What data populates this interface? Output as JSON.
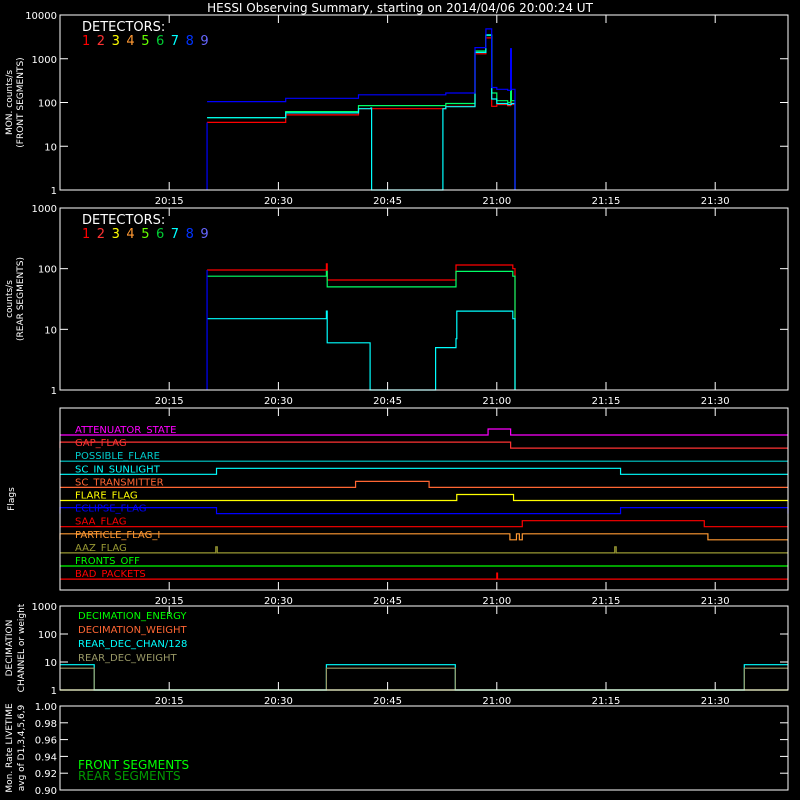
{
  "title": "HESSI Observing Summary, starting on 2014/04/06 20:00:24 UT",
  "colors": {
    "det": [
      "#ff0000",
      "#ff3333",
      "#ffff00",
      "#ff9933",
      "#66ff00",
      "#00cc33",
      "#00ffff",
      "#0033ff",
      "#6666ff"
    ]
  },
  "chart_data": [
    {
      "type": "line",
      "ylabel": "MON. counts/s (FRONT SEGMENTS)",
      "yscale": "log",
      "ylim": [
        1,
        10000
      ],
      "yticks": [
        "1",
        "10",
        "100",
        "1000",
        "10000"
      ],
      "xlabels": [
        "20:15",
        "20:30",
        "20:45",
        "21:00",
        "21:15",
        "21:30"
      ],
      "legend_title": "DETECTORS:",
      "legend_numbers": [
        "1",
        "2",
        "3",
        "4",
        "5",
        "6",
        "7",
        "8",
        "9"
      ],
      "series": [
        {
          "name": "1",
          "color": "#ff0000",
          "x": [
            20.2,
            31,
            41,
            53,
            57,
            58.5,
            59.3,
            60,
            61.5,
            61.9,
            62,
            62.5
          ],
          "y": [
            35,
            52,
            72,
            82,
            1300,
            3000,
            82,
            90,
            85,
            1100,
            90,
            1
          ]
        },
        {
          "name": "6",
          "color": "#00ff66",
          "x": [
            20.2,
            31,
            41,
            53,
            57,
            58.5,
            59.3,
            60,
            61.5,
            61.9,
            62,
            62.5
          ],
          "y": [
            45,
            62,
            85,
            95,
            1500,
            3400,
            165,
            110,
            100,
            1300,
            110,
            1
          ]
        },
        {
          "name": "7",
          "color": "#00ffff",
          "x": [
            20.2,
            31,
            41,
            42.7,
            42.8,
            52.5,
            52.6,
            53,
            57,
            58.5,
            59.3,
            60,
            61.5,
            62,
            62.5
          ],
          "y": [
            45,
            58,
            72,
            75,
            1,
            1,
            72,
            80,
            1400,
            3500,
            120,
            95,
            90,
            95,
            1
          ]
        },
        {
          "name": "8",
          "color": "#0000ff",
          "x": [
            20.2,
            31,
            41,
            53,
            57,
            58.5,
            59.3,
            60,
            61.5,
            61.9,
            62,
            62.5
          ],
          "y": [
            105,
            125,
            150,
            165,
            1800,
            4800,
            220,
            200,
            190,
            1700,
            200,
            1
          ]
        }
      ]
    },
    {
      "type": "line",
      "ylabel": "counts/s (REAR SEGMENTS)",
      "yscale": "log",
      "ylim": [
        1,
        1000
      ],
      "yticks": [
        "1",
        "10",
        "100",
        "1000"
      ],
      "xlabels": [
        "20:15",
        "20:30",
        "20:45",
        "21:00",
        "21:15",
        "21:30"
      ],
      "legend_title": "DETECTORS:",
      "legend_numbers": [
        "1",
        "2",
        "3",
        "4",
        "5",
        "6",
        "7",
        "8",
        "9"
      ],
      "series": [
        {
          "name": "1",
          "color": "#ff0000",
          "x": [
            20.2,
            36.6,
            36.7,
            54.3,
            54.4,
            62.2,
            62.5
          ],
          "y": [
            95,
            120,
            65,
            65,
            115,
            100,
            1
          ]
        },
        {
          "name": "5",
          "color": "#00ff66",
          "x": [
            20.2,
            36.6,
            36.7,
            54.3,
            54.4,
            62.2,
            62.5
          ],
          "y": [
            75,
            90,
            50,
            50,
            90,
            75,
            1
          ]
        },
        {
          "name": "7",
          "color": "#00ffff",
          "x": [
            20.2,
            36.6,
            36.7,
            38.4,
            38.5,
            42.6,
            42.7,
            51.5,
            51.6,
            54.4,
            54.5,
            62.2,
            62.5
          ],
          "y": [
            15,
            20,
            6,
            6,
            6,
            1,
            1,
            1,
            5,
            7,
            20,
            15,
            1
          ]
        }
      ]
    },
    {
      "type": "table",
      "ylabel": "Flags",
      "xlabels": [
        "20:15",
        "20:30",
        "20:45",
        "21:00",
        "21:15",
        "21:30"
      ],
      "flags": [
        {
          "name": "ATTENUATOR_STATE",
          "color": "#ff00ff",
          "segments": [
            [
              58.8,
              61.9
            ]
          ]
        },
        {
          "name": "GAP_FLAG",
          "color": "#ff3333",
          "segments": [
            [
              0,
              61.9
            ]
          ]
        },
        {
          "name": "POSSIBLE_FLARE",
          "color": "#00cccc",
          "segments": []
        },
        {
          "name": "SC_IN_SUNLIGHT",
          "color": "#00ffff",
          "segments": [
            [
              21.5,
              77
            ]
          ]
        },
        {
          "name": "SC_TRANSMITTER",
          "color": "#ff6633",
          "segments": [
            [
              40.6,
              50.7
            ]
          ]
        },
        {
          "name": "FLARE_FLAG",
          "color": "#ffff00",
          "segments": [
            [
              54.5,
              62.3
            ]
          ]
        },
        {
          "name": "ECLIPSE_FLAG",
          "color": "#0000ff",
          "segments": [
            [
              0,
              21.5
            ],
            [
              77,
              100
            ]
          ]
        },
        {
          "name": "SAA_FLAG",
          "color": "#ff0000",
          "segments": [
            [
              63.5,
              88.5
            ]
          ]
        },
        {
          "name": "PARTICLE_FLAG_I",
          "color": "#ff9933",
          "segments": [
            [
              0,
              61.8
            ],
            [
              62.7,
              63.1
            ],
            [
              63.5,
              89
            ]
          ]
        },
        {
          "name": "AAZ_FLAG",
          "color": "#999933",
          "segments": [
            [
              21.4,
              21.6
            ],
            [
              76.2,
              76.4
            ]
          ]
        },
        {
          "name": "FRONTS_OFF",
          "color": "#00ff00",
          "segments": []
        },
        {
          "name": "BAD_PACKETS",
          "color": "#ff0000",
          "segments": [
            [
              60,
              60.1
            ]
          ]
        }
      ]
    },
    {
      "type": "line",
      "ylabel": "DECIMATION CHANNEL or weight",
      "yscale": "log",
      "ylim": [
        1,
        1000
      ],
      "yticks": [
        "1",
        "10",
        "100",
        "1000"
      ],
      "xlabels": [
        "20:15",
        "20:30",
        "20:45",
        "21:00",
        "21:15",
        "21:30"
      ],
      "legend": [
        "DECIMATION_ENERGY",
        "DECIMATION_WEIGHT",
        "REAR_DEC_CHAN/128",
        "REAR_DEC_WEIGHT"
      ],
      "series": [
        {
          "name": "DECIMATION_ENERGY",
          "color": "#00ff00",
          "x": [
            0,
            100
          ],
          "y": [
            1,
            1
          ]
        },
        {
          "name": "DECIMATION_WEIGHT",
          "color": "#ff6633",
          "x": [
            0,
            100
          ],
          "y": [
            1,
            1
          ]
        },
        {
          "name": "REAR_DEC_CHAN/128",
          "color": "#00ffff",
          "x": [
            0,
            4.6,
            4.7,
            36.5,
            36.6,
            54.2,
            54.3,
            93.9,
            94,
            100
          ],
          "y": [
            8,
            8,
            1,
            1,
            8,
            8,
            1,
            1,
            8,
            8
          ]
        },
        {
          "name": "REAR_DEC_WEIGHT",
          "color": "#999966",
          "x": [
            0,
            4.6,
            4.7,
            36.5,
            36.6,
            54.2,
            54.3,
            93.9,
            94,
            100
          ],
          "y": [
            6,
            6,
            1,
            1,
            6,
            6,
            1,
            1,
            6,
            6
          ]
        }
      ]
    },
    {
      "type": "line",
      "ylabel": "Mon. Rate LIVETIME avg of D1,3,4,5,6,9",
      "ylim": [
        0.9,
        1.0
      ],
      "yticks": [
        "0.90",
        "0.92",
        "0.94",
        "0.96",
        "0.98",
        "1.00"
      ],
      "legend": [
        "FRONT SEGMENTS",
        "REAR SEGMENTS"
      ],
      "legend_colors": [
        "#00ff00",
        "#009900"
      ],
      "series": []
    }
  ]
}
